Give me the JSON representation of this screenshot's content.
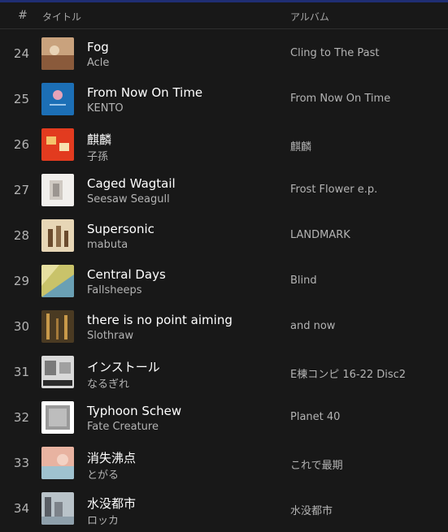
{
  "header": {
    "number_symbol": "#",
    "title_label": "タイトル",
    "album_label": "アルバム"
  },
  "tracks": [
    {
      "number": "24",
      "title": "Fog",
      "artist": "Acle",
      "album": "Cling to The Past",
      "cover_colors": [
        "#c9a27d",
        "#8a5a3b"
      ]
    },
    {
      "number": "25",
      "title": "From Now On Time",
      "artist": "KENTO",
      "album": "From Now On Time",
      "cover_colors": [
        "#1c6fb6",
        "#e6a3b8"
      ]
    },
    {
      "number": "26",
      "title": "麒麟",
      "artist": "子孫",
      "album": "麒麟",
      "cover_colors": [
        "#e23b1f",
        "#f4c36b"
      ]
    },
    {
      "number": "27",
      "title": "Caged Wagtail",
      "artist": "Seesaw Seagull",
      "album": "Frost Flower e.p.",
      "cover_colors": [
        "#f1efec",
        "#9b9590"
      ]
    },
    {
      "number": "28",
      "title": "Supersonic",
      "artist": "mabuta",
      "album": "LANDMARK",
      "cover_colors": [
        "#e7d6b6",
        "#6b4b2e"
      ]
    },
    {
      "number": "29",
      "title": "Central Days",
      "artist": "Fallsheeps",
      "album": "Blind",
      "cover_colors": [
        "#c9c36a",
        "#6aa0b4"
      ]
    },
    {
      "number": "30",
      "title": "there is no point aiming",
      "artist": "Slothraw",
      "album": "and now",
      "cover_colors": [
        "#4a3a22",
        "#c99a4a"
      ]
    },
    {
      "number": "31",
      "title": "インストール",
      "artist": "なるぎれ",
      "album": "E棟コンピ 16-22 Disc2",
      "cover_colors": [
        "#d9d9d9",
        "#2b2b2b"
      ]
    },
    {
      "number": "32",
      "title": "Typhoon Schew",
      "artist": "Fate Creature",
      "album": "Planet 40",
      "cover_colors": [
        "#ffffff",
        "#9a9a9a"
      ]
    },
    {
      "number": "33",
      "title": "消失沸点",
      "artist": "とがる",
      "album": "これで最期",
      "cover_colors": [
        "#e8b3a1",
        "#9fc2cf"
      ]
    },
    {
      "number": "34",
      "title": "水没都市",
      "artist": "ロッカ",
      "album": "水没都市",
      "cover_colors": [
        "#b9c3c9",
        "#5a5f66"
      ]
    }
  ]
}
